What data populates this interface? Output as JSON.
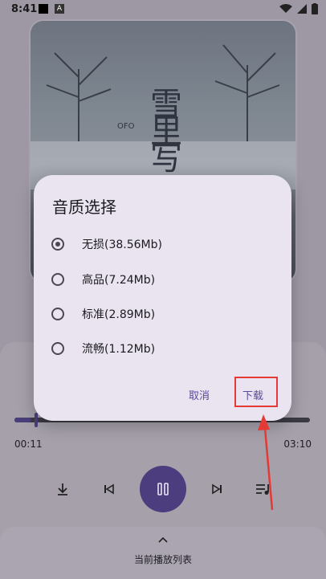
{
  "status_bar": {
    "time": "8:41",
    "indicator": "A"
  },
  "album": {
    "calligraphy": "雪里写",
    "tag": "OFO"
  },
  "dialog": {
    "title": "音质选择",
    "options": [
      {
        "label": "无损(38.56Mb)",
        "selected": true
      },
      {
        "label": "高品(7.24Mb)",
        "selected": false
      },
      {
        "label": "标准(2.89Mb)",
        "selected": false
      },
      {
        "label": "流畅(1.12Mb)",
        "selected": false
      }
    ],
    "cancel": "取消",
    "download": "下载"
  },
  "player": {
    "elapsed": "00:11",
    "duration": "03:10",
    "progress": 0.058
  },
  "bottom_bar": {
    "label": "当前播放列表"
  },
  "colors": {
    "accent": "#4b3d7e",
    "highlight": "#e53935"
  }
}
